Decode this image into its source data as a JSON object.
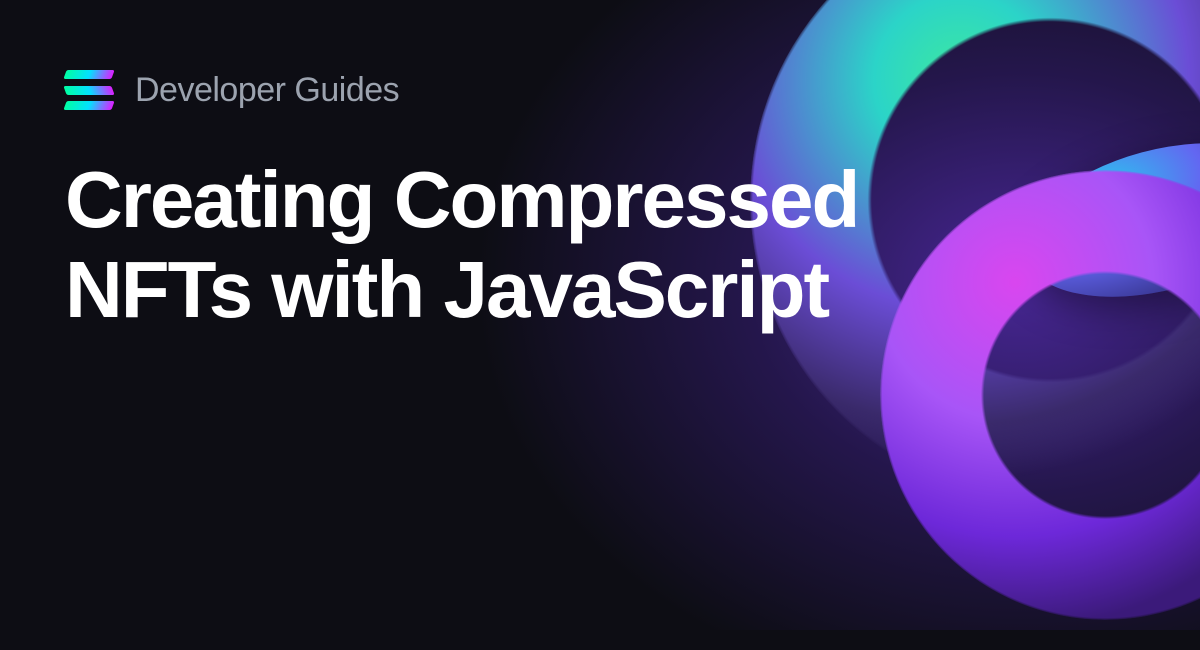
{
  "header": {
    "breadcrumb": "Developer Guides"
  },
  "title": "Creating Compressed NFTs with JavaScript",
  "brand": {
    "name": "Solana",
    "gradient_colors": [
      "#00ffa3",
      "#03e1ff",
      "#dc1fff"
    ]
  }
}
